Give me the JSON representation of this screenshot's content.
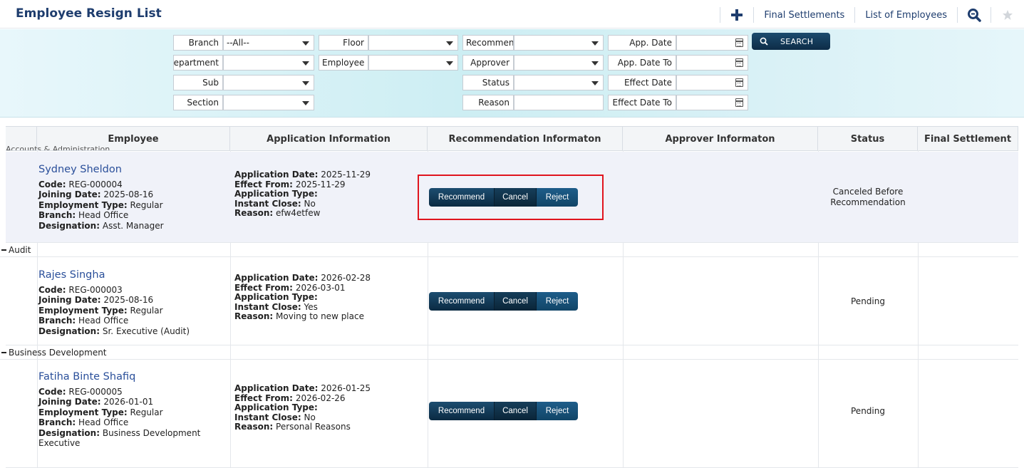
{
  "header": {
    "title": "Employee Resign List",
    "final_settlements": "Final Settlements",
    "list_of_employees": "List of Employees"
  },
  "filters": {
    "branch_label": "Branch",
    "branch_value": "--All--",
    "department_label": "Department",
    "sub_label": "Sub",
    "section_label": "Section",
    "floor_label": "Floor",
    "employee_label": "Employee",
    "recommender_label": "Recommender",
    "approver_label": "Approver",
    "status_label": "Status",
    "reason_label": "Reason",
    "app_date_label": "App. Date",
    "app_date_to_label": "App. Date To",
    "effect_date_label": "Effect Date",
    "effect_date_to_label": "Effect Date To",
    "search_label": "SEARCH"
  },
  "table": {
    "columns": [
      "Employee",
      "Application Information",
      "Recommendation Informaton",
      "Approver Informaton",
      "Status",
      "Final Settlement"
    ],
    "cut_group": "Accounts & Administration",
    "labels": {
      "code": "Code:",
      "joining": "Joining Date:",
      "emp_type": "Employment Type:",
      "branch": "Branch:",
      "designation": "Designation:",
      "app_date": "Application Date:",
      "effect_from": "Effect From:",
      "app_type": "Application Type:",
      "instant_close": "Instant Close:",
      "reason": "Reason:"
    },
    "buttons": {
      "recommend": "Recommend",
      "cancel": "Cancel",
      "reject": "Reject"
    },
    "groups": [
      "Audit",
      "Business Development"
    ],
    "rows": [
      {
        "name": "Sydney Sheldon",
        "code": "REG-000004",
        "joining": "2025-08-16",
        "emp_type": "Regular",
        "branch": "Head Office",
        "designation": "Asst. Manager",
        "app_date": "2025-11-29",
        "effect_from": "2025-11-29",
        "instant_close": "No",
        "reason": "efw4etfew",
        "status_line1": "Canceled  Before",
        "status_line2": "Recommendation"
      },
      {
        "name": "Rajes Singha",
        "code": "REG-000003",
        "joining": "2025-08-16",
        "emp_type": "Regular",
        "branch": "Head Office",
        "designation": "Sr. Executive (Audit)",
        "app_date": "2026-02-28",
        "effect_from": "2026-03-01",
        "instant_close": "Yes",
        "reason": "Moving to new place",
        "status": "Pending"
      },
      {
        "name": "Fatiha Binte Shafiq",
        "code": "REG-000005",
        "joining": "2026-01-01",
        "emp_type": "Regular",
        "branch": "Head Office",
        "designation_line1": "Business Development",
        "designation_line2": "Executive",
        "app_date": "2026-01-25",
        "effect_from": "2026-02-26",
        "instant_close": "No",
        "reason": "Personal Reasons",
        "status": "Pending"
      }
    ]
  },
  "icons": {
    "add": "plus-icon",
    "search": "magnifier-icon",
    "favorite": "star-icon",
    "calendar": "calendar-icon"
  },
  "colors": {
    "title": "#1e3d6e",
    "button_dark": "#0b2a42",
    "highlight_box": "#e0141e",
    "name_link": "#2a4f9a"
  }
}
